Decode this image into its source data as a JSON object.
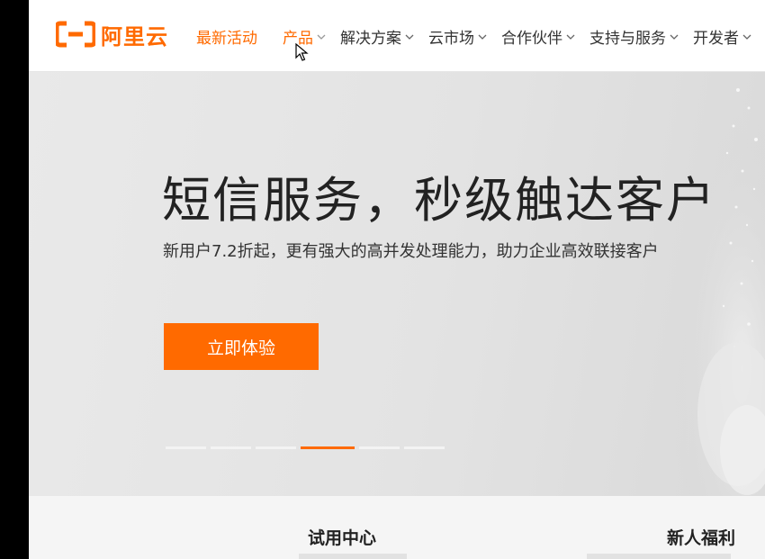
{
  "brand": {
    "name": "阿里云",
    "color": "#ff6a00"
  },
  "nav": {
    "promo": "最新活动",
    "items": [
      {
        "label": "产品",
        "icon": "chevron-down-icon",
        "active": true
      },
      {
        "label": "解决方案",
        "icon": "chevron-down-icon"
      },
      {
        "label": "云市场",
        "icon": "chevron-down-icon"
      },
      {
        "label": "合作伙伴",
        "icon": "chevron-down-icon"
      },
      {
        "label": "支持与服务",
        "icon": "chevron-down-icon"
      },
      {
        "label": "开发者",
        "icon": "chevron-down-icon"
      }
    ]
  },
  "hero": {
    "title": "短信服务，秒级触达客户",
    "subtitle": "新用户7.2折起，更有强大的高并发处理能力，助力企业高效联接客户",
    "cta": "立即体验",
    "carousel_count": 6,
    "carousel_active": 4
  },
  "sections": {
    "trial": "试用中心",
    "welfare": "新人福利"
  }
}
